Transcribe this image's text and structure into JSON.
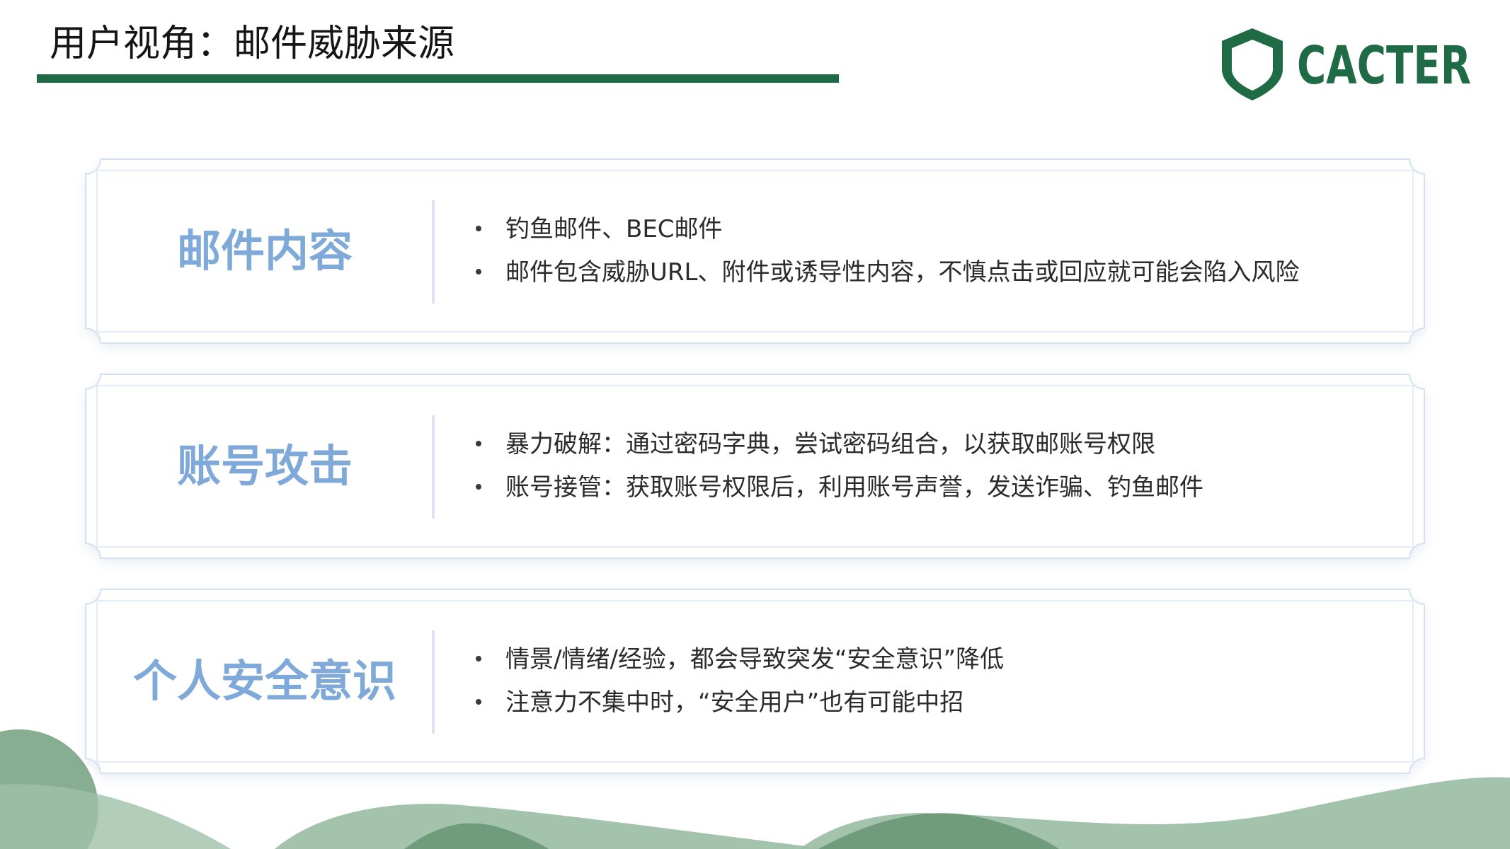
{
  "header": {
    "title": "用户视角：邮件威胁来源"
  },
  "logo": {
    "text": "CACTER",
    "icon": "shield-icon"
  },
  "colors": {
    "accent": "#1e6b45",
    "card_title": "#7fa9d8",
    "text": "#2b2b2b",
    "wave_light": "#9fc0a8",
    "wave_dark": "#5f8f6c"
  },
  "cards": [
    {
      "title": "邮件内容",
      "bullets": [
        "钓鱼邮件、BEC邮件",
        "邮件包含威胁URL、附件或诱导性内容，不慎点击或回应就可能会陷入风险"
      ]
    },
    {
      "title": "账号攻击",
      "bullets": [
        "暴力破解：通过密码字典，尝试密码组合，以获取邮账号权限",
        "账号接管：获取账号权限后，利用账号声誉，发送诈骗、钓鱼邮件"
      ]
    },
    {
      "title": "个人安全意识",
      "bullets": [
        "情景/情绪/经验，都会导致突发“安全意识”降低",
        "注意力不集中时，“安全用户”也有可能中招"
      ]
    }
  ]
}
